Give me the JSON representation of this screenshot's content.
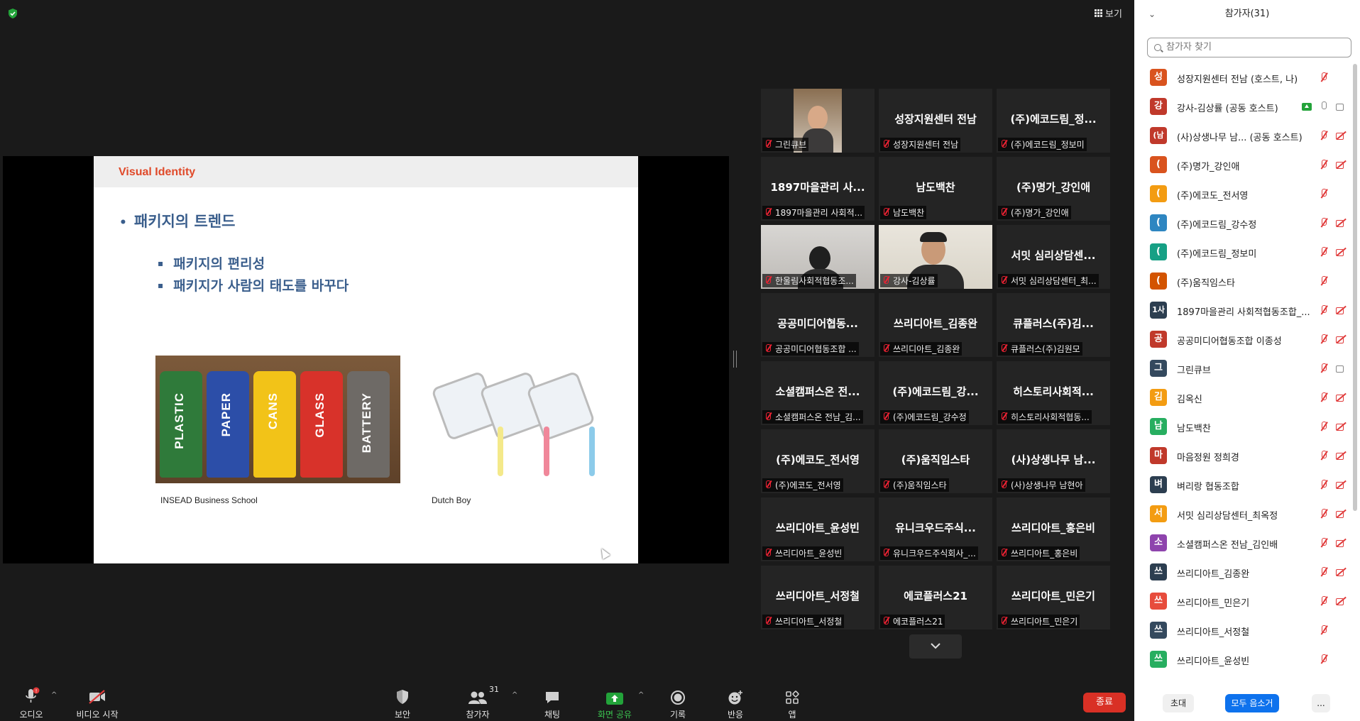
{
  "topbar": {
    "view_label": "보기"
  },
  "slide": {
    "title": "Visual Identity",
    "bullet_main": "패키지의 트렌드",
    "bullet_sub": [
      "패키지의 편리성",
      "패키지가 사람의 태도를 바꾸다"
    ],
    "caption_left": "INSEAD Business School",
    "caption_right": "Dutch Boy",
    "bin_labels": [
      "PLASTIC",
      "PAPER",
      "CANS",
      "GLASS",
      "BATTERY"
    ]
  },
  "gallery": {
    "tiles": [
      {
        "name": "",
        "label": "그린큐브",
        "video": true
      },
      {
        "name": "성장지원센터 전남",
        "label": "성장지원센터 전남"
      },
      {
        "name": "(주)에코드림_정...",
        "label": "(주)에코드림_정보미"
      },
      {
        "name": "1897마을관리 사...",
        "label": "1897마을관리 사회적..."
      },
      {
        "name": "남도백찬",
        "label": "남도백찬"
      },
      {
        "name": "(주)명가_강인애",
        "label": "(주)명가_강인애"
      },
      {
        "name": "",
        "label": "한울림사회적협동조...",
        "video": true
      },
      {
        "name": "",
        "label": "강사-김상률",
        "video": true,
        "active": true
      },
      {
        "name": "서밋 심리상담센...",
        "label": "서밋 심리상담센터_최..."
      },
      {
        "name": "공공미디어협동...",
        "label": "공공미디어협동조합 ..."
      },
      {
        "name": "쓰리디아트_김종완",
        "label": "쓰리디아트_김종완"
      },
      {
        "name": "큐플러스(주)김...",
        "label": "큐플러스(주)김원모"
      },
      {
        "name": "소셜캠퍼스온 전...",
        "label": "소셜캠퍼스온 전남_김..."
      },
      {
        "name": "(주)에코드림_강...",
        "label": "(주)에코드림_강수정"
      },
      {
        "name": "히스토리사회적...",
        "label": "히스토리사회적협동..."
      },
      {
        "name": "(주)에코도_전서영",
        "label": "(주)에코도_전서영"
      },
      {
        "name": "(주)움직임스타",
        "label": "(주)움직임스타"
      },
      {
        "name": "(사)상생나무 남...",
        "label": "(사)상생나무 남현아"
      },
      {
        "name": "쓰리디아트_윤성빈",
        "label": "쓰리디아트_윤성빈"
      },
      {
        "name": "유니크우드주식...",
        "label": "유니크우드주식회사_..."
      },
      {
        "name": "쓰리디아트_홍은비",
        "label": "쓰리디아트_홍은비"
      },
      {
        "name": "쓰리디아트_서정철",
        "label": "쓰리디아트_서정철"
      },
      {
        "name": "에코플러스21",
        "label": "에코플러스21"
      },
      {
        "name": "쓰리디아트_민은기",
        "label": "쓰리디아트_민은기"
      }
    ]
  },
  "toolbar": {
    "audio": "오디오",
    "video": "비디오 시작",
    "security": "보안",
    "participants": "참가자",
    "participants_count": "31",
    "chat": "채팅",
    "share": "화면 공유",
    "record": "기록",
    "reactions": "반응",
    "apps": "앱",
    "end": "종료"
  },
  "panel": {
    "title": "참가자(31)",
    "search_placeholder": "참가자 찾기",
    "invite": "초대",
    "mute_all": "모두 음소거",
    "more": "...",
    "participants": [
      {
        "initial": "성",
        "color": "#d9531e",
        "name": "성장지원센터 전남 (호스트, 나)",
        "cam": false,
        "mic": "off",
        "cam_state": "none"
      },
      {
        "initial": "강",
        "color": "#c0392b",
        "name": "강사-김상률 (공동 호스트)",
        "share": true,
        "mic": "on",
        "cam_state": "on"
      },
      {
        "initial": "(남",
        "color": "#c0392b",
        "name": "(사)상생나무 남...   (공동 호스트)",
        "mic": "off",
        "cam_state": "off"
      },
      {
        "initial": "(",
        "color": "#d9531e",
        "name": "(주)명가_강인애",
        "mic": "off",
        "cam_state": "off"
      },
      {
        "initial": "(",
        "color": "#f39c12",
        "name": "(주)에코도_전서영",
        "mic": "off",
        "cam_state": "none"
      },
      {
        "initial": "(",
        "color": "#2e86c1",
        "name": "(주)에코드림_강수정",
        "mic": "off",
        "cam_state": "off"
      },
      {
        "initial": "(",
        "color": "#16a085",
        "name": "(주)에코드림_정보미",
        "mic": "off",
        "cam_state": "off"
      },
      {
        "initial": "(",
        "color": "#d35400",
        "name": "(주)움직임스타",
        "mic": "off",
        "cam_state": "none"
      },
      {
        "initial": "1사",
        "color": "#2c3e50",
        "name": "1897마을관리 사회적협동조합_...",
        "mic": "off",
        "cam_state": "off"
      },
      {
        "initial": "공",
        "color": "#c0392b",
        "name": "공공미디어협동조합 이종성",
        "mic": "off",
        "cam_state": "off"
      },
      {
        "initial": "그",
        "color": "#34495e",
        "name": "그린큐브",
        "mic": "off",
        "cam_state": "on"
      },
      {
        "initial": "김",
        "color": "#f39c12",
        "name": "김옥신",
        "mic": "off",
        "cam_state": "off"
      },
      {
        "initial": "남",
        "color": "#27ae60",
        "name": "남도백찬",
        "mic": "off",
        "cam_state": "off"
      },
      {
        "initial": "마",
        "color": "#c0392b",
        "name": "마음정원 정희경",
        "mic": "off",
        "cam_state": "off"
      },
      {
        "initial": "벼",
        "color": "#2c3e50",
        "name": "벼리랑 협동조합",
        "mic": "off",
        "cam_state": "off"
      },
      {
        "initial": "서",
        "color": "#f39c12",
        "name": "서밋 심리상담센터_최옥정",
        "mic": "off",
        "cam_state": "off"
      },
      {
        "initial": "소",
        "color": "#8e44ad",
        "name": "소셜캠퍼스온 전남_김인배",
        "mic": "off",
        "cam_state": "off"
      },
      {
        "initial": "쓰",
        "color": "#2c3e50",
        "name": "쓰리디아트_김종완",
        "mic": "off",
        "cam_state": "off"
      },
      {
        "initial": "쓰",
        "color": "#e74c3c",
        "name": "쓰리디아트_민은기",
        "mic": "off",
        "cam_state": "off"
      },
      {
        "initial": "쓰",
        "color": "#34495e",
        "name": "쓰리디아트_서정철",
        "mic": "off",
        "cam_state": "none"
      },
      {
        "initial": "쓰",
        "color": "#27ae60",
        "name": "쓰리디아트_윤성빈",
        "mic": "off",
        "cam_state": "none"
      }
    ]
  }
}
